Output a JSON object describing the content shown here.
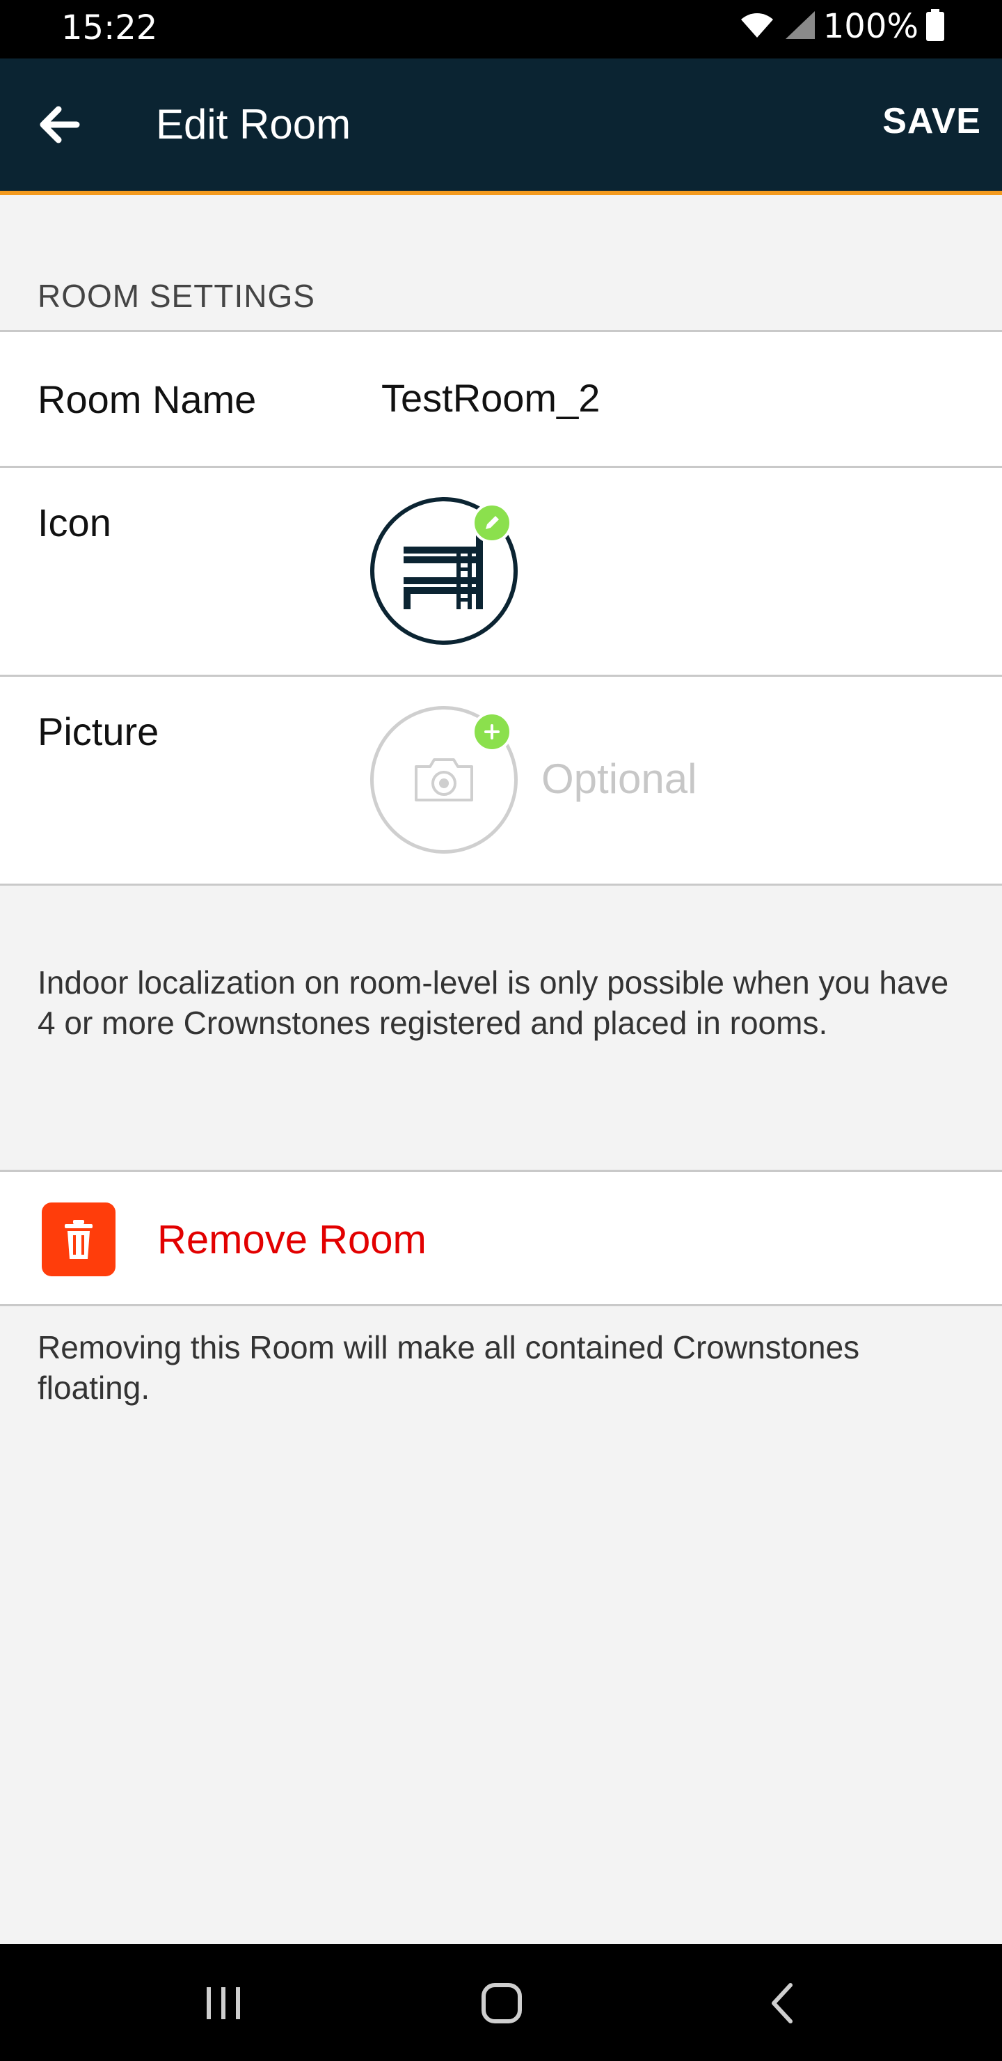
{
  "status_bar": {
    "time": "15:22",
    "battery": "100%",
    "icons": [
      "wifi-icon",
      "signal-icon",
      "battery-icon"
    ]
  },
  "app_bar": {
    "title": "Edit Room",
    "save_label": "SAVE",
    "back_icon": "arrow-left-icon",
    "accent_color": "#f39a1e",
    "background_color": "#0b2432"
  },
  "settings": {
    "section_title": "ROOM SETTINGS",
    "room_name_label": "Room Name",
    "room_name_value": "TestRoom_2",
    "icon_label": "Icon",
    "icon_name": "bunk-bed-icon",
    "picture_label": "Picture",
    "picture_placeholder": "Optional"
  },
  "info_text": "Indoor localization on room-level is only possible when you have 4 or more Crownstones registered and placed in rooms.",
  "remove": {
    "label": "Remove Room",
    "note": "Removing this Room will make all contained Crownstones floating.",
    "color": "#e20000",
    "icon_bg": "#ff3d0b"
  },
  "nav_bar": {
    "buttons": [
      "recent-apps-icon",
      "home-icon",
      "back-icon"
    ]
  }
}
